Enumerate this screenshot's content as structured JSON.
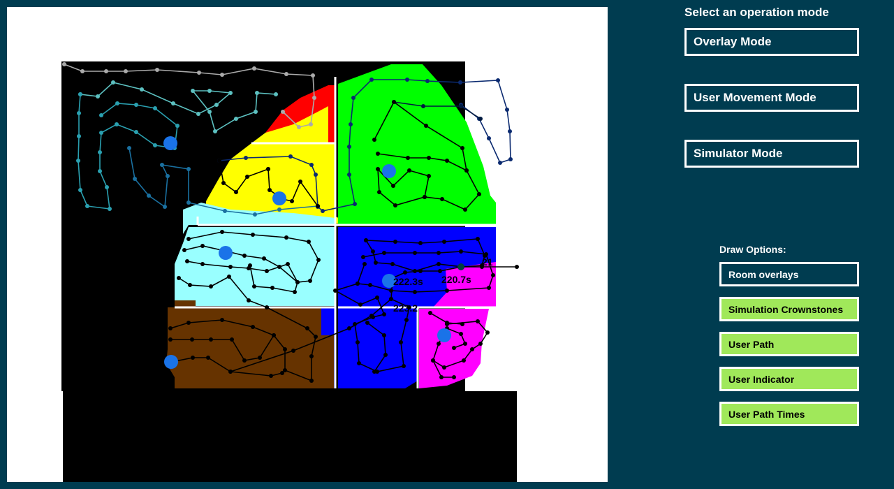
{
  "mode_panel": {
    "heading": "Select an operation mode",
    "buttons": [
      "Overlay Mode",
      "User Movement Mode",
      "Simulator Mode"
    ]
  },
  "draw_options": {
    "heading": "Draw Options:",
    "items": [
      {
        "label": "Room overlays",
        "active": false
      },
      {
        "label": "Simulation Crownstones",
        "active": true
      },
      {
        "label": "User Path",
        "active": true
      },
      {
        "label": "User Indicator",
        "active": true
      },
      {
        "label": "User Path Times",
        "active": true
      }
    ]
  },
  "map": {
    "time_labels": [
      "222.3s",
      "220.7s",
      "223.2",
      "21"
    ],
    "colors": {
      "background": "#003c50",
      "red": "#ff0000",
      "yellow": "#ffff00",
      "green": "#00ff00",
      "cyan": "#99ffff",
      "blue": "#0000ff",
      "magenta": "#ff00ff",
      "brown": "#663300",
      "crownstone": "#1a73e8",
      "active_button": "#a0e85a"
    }
  }
}
